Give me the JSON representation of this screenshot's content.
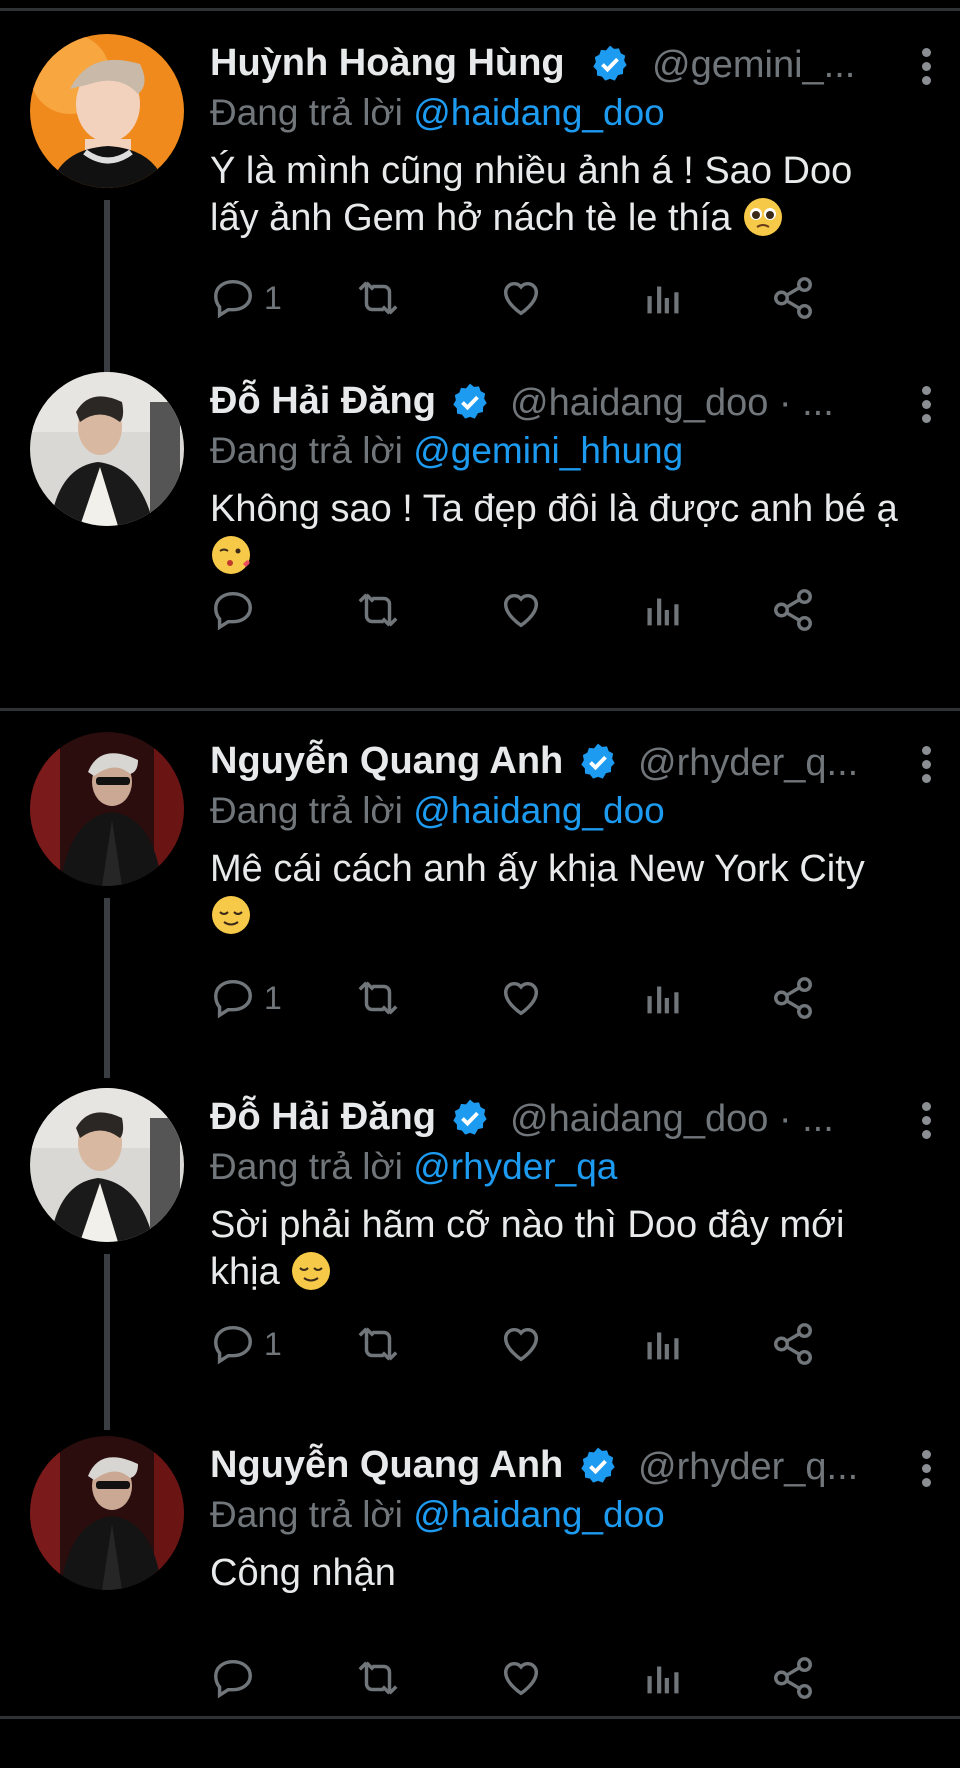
{
  "colors": {
    "background": "#000000",
    "text": "#e7e9ea",
    "muted": "#71767b",
    "accent": "#1d9bf0",
    "divider": "#2f3336"
  },
  "reply_prefix": "Đang trả lời",
  "tweets": [
    {
      "name": "Huỳnh Hoàng Hùng",
      "handle": "@gemini_...",
      "verified": true,
      "reply_to": "@haidang_doo",
      "text": "Ý là mình cũng nhiều ảnh á ! Sao Doo lấy ảnh Gem hở nách tè le thía",
      "emoji": "pleading-face",
      "reply_count": "1",
      "avatar": "avatar-huynh-hoang-hung"
    },
    {
      "name": "Đỗ Hải Đăng",
      "handle": "@haidang_doo · ...",
      "verified": true,
      "reply_to": "@gemini_hhung",
      "text": "Không sao ! Ta đẹp đôi là được anh bé ạ",
      "emoji": "kissing-face",
      "reply_count": "",
      "avatar": "avatar-do-hai-dang"
    },
    {
      "name": "Nguyễn Quang Anh",
      "handle": "@rhyder_q...",
      "verified": true,
      "reply_to": "@haidang_doo",
      "text": "Mê cái cách anh ấy khịa New York City",
      "emoji": "relieved-face",
      "reply_count": "1",
      "avatar": "avatar-nguyen-quang-anh"
    },
    {
      "name": "Đỗ Hải Đăng",
      "handle": "@haidang_doo · ...",
      "verified": true,
      "reply_to": "@rhyder_qa",
      "text": "Sời phải hãm cỡ nào thì Doo đây mới khịa",
      "emoji": "relieved-face",
      "reply_count": "1",
      "avatar": "avatar-do-hai-dang"
    },
    {
      "name": "Nguyễn Quang Anh",
      "handle": "@rhyder_q...",
      "verified": true,
      "reply_to": "@haidang_doo",
      "text": "Công nhận",
      "emoji": "",
      "reply_count": "",
      "avatar": "avatar-nguyen-quang-anh"
    }
  ]
}
